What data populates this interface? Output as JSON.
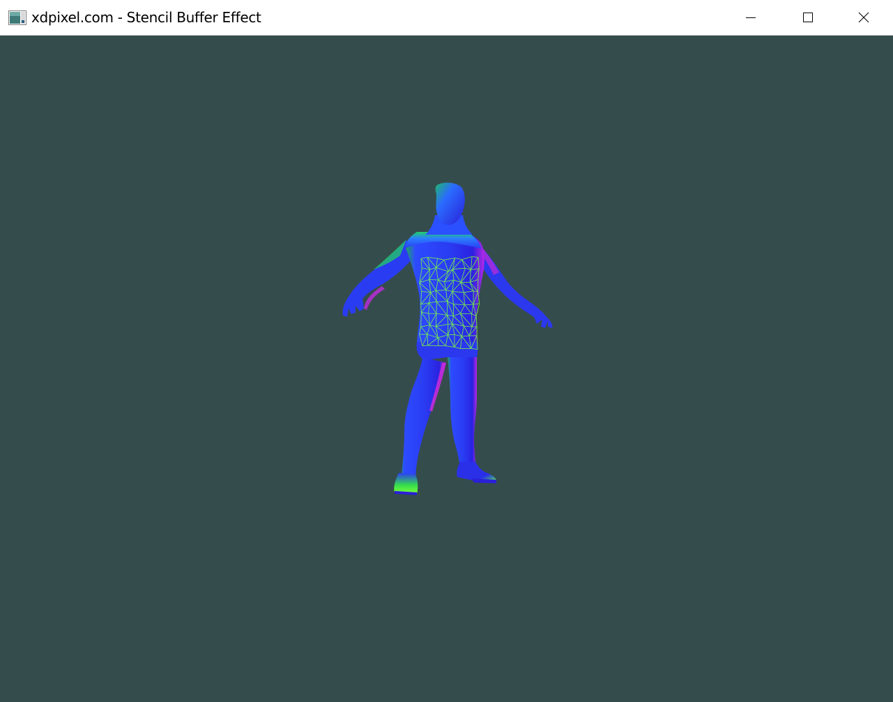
{
  "window": {
    "title": "xdpixel.com - Stencil Buffer Effect",
    "app_icon": "app-window-icon",
    "controls": {
      "minimize_icon": "minimize-icon",
      "maximize_icon": "maximize-icon",
      "close_icon": "close-icon"
    }
  },
  "scene": {
    "background_color": "#354c4d",
    "model": "humanoid-figure",
    "model_shading": "normal-colored (blue / green / magenta)",
    "wireframe_color": "#7dff3a",
    "wireframe_region": "torso"
  }
}
